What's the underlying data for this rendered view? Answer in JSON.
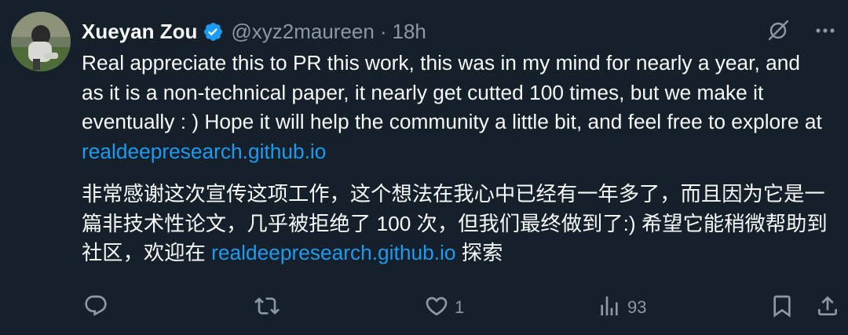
{
  "author": {
    "display_name": "Xueyan Zou",
    "handle": "@xyz2maureen",
    "separator": "·",
    "time": "18h"
  },
  "body": {
    "para1_text": "Real appreciate this to PR this work, this was in my mind for nearly a year, and as it is a non-technical paper, it nearly get cutted 100 times, but we make it eventually : ) Hope it will help the community a little bit, and feel free to explore at ",
    "para1_link": "realdeepresearch.github.io",
    "para2_text": "非常感谢这次宣传这项工作，这个想法在我心中已经有一年多了，而且因为它是一篇非技术性论文，几乎被拒绝了 100 次，但我们最终做到了:) 希望它能稍微帮助到社区，欢迎在 ",
    "para2_link": "realdeepresearch.github.io",
    "para2_suffix": " 探索"
  },
  "metrics": {
    "reply_count": "",
    "retweet_count": "",
    "like_count": "1",
    "view_count": "93"
  },
  "colors": {
    "background": "#15202b",
    "text": "#f7f9f9",
    "secondary": "#8b98a5",
    "link": "#1d9bf0",
    "verified": "#1d9bf0"
  },
  "icons": {
    "verified": "verified-badge-icon",
    "grok": "grok-icon",
    "more": "more-icon",
    "reply": "reply-icon",
    "retweet": "retweet-icon",
    "like": "heart-icon",
    "views": "views-icon",
    "bookmark": "bookmark-icon",
    "share": "share-icon"
  }
}
